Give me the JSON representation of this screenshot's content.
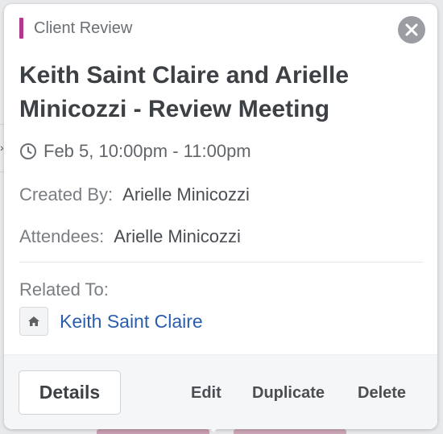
{
  "popover": {
    "category_label": "Client Review",
    "category_color": "#b0388f",
    "close_icon": "close-icon",
    "title": "Keith Saint Claire and Arielle Minicozzi - Review Meeting",
    "time_icon": "clock-icon",
    "time_range": "Feb 5, 10:00pm - 11:00pm",
    "created_by_label": "Created By:",
    "created_by_value": "Arielle Minicozzi",
    "attendees_label": "Attendees:",
    "attendees_value": "Arielle Minicozzi",
    "related_label": "Related To:",
    "related_icon": "home-icon",
    "related_value": "Keith Saint Claire",
    "link_color": "#2a5db0"
  },
  "footer": {
    "details_label": "Details",
    "edit_label": "Edit",
    "duplicate_label": "Duplicate",
    "delete_label": "Delete"
  }
}
